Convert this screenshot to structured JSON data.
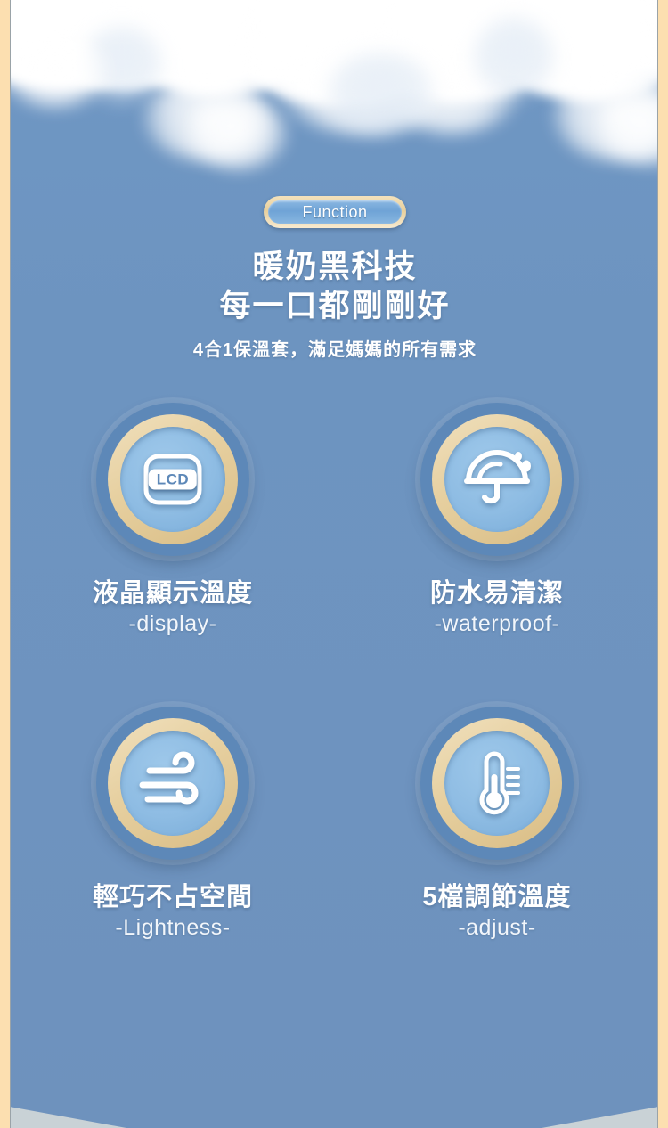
{
  "badge": {
    "label": "Function"
  },
  "headline": {
    "line1": "暖奶黑科技",
    "line2": "每一口都剛剛好",
    "subtitle": "4合1保溫套，滿足媽媽的所有需求"
  },
  "features": [
    {
      "icon": "lcd-screen-icon",
      "icon_text": "LCD",
      "title_cn": "液晶顯示溫度",
      "title_en": "-display-"
    },
    {
      "icon": "umbrella-raindrop-icon",
      "title_cn": "防水易清潔",
      "title_en": "-waterproof-"
    },
    {
      "icon": "wind-breeze-icon",
      "title_cn": "輕巧不占空間",
      "title_en": "-Lightness-"
    },
    {
      "icon": "thermometer-icon",
      "title_cn": "5檔調節溫度",
      "title_en": "-adjust-"
    }
  ],
  "colors": {
    "background_blue": "#6e93bf",
    "side_stripe_cream": "#fcdfb0",
    "ring_gold": "#e6cf9f",
    "ring_outer_blue": "#5d88b8",
    "icon_white": "#ffffff",
    "corner_wedge": "#c9d2d6"
  }
}
